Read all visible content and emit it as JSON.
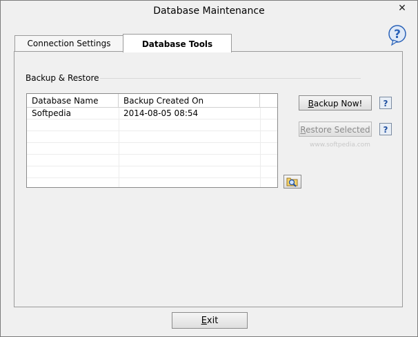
{
  "window": {
    "title": "Database Maintenance",
    "close_glyph": "✕"
  },
  "tabs": [
    {
      "label": "Connection Settings"
    },
    {
      "label": "Database Tools"
    }
  ],
  "group": {
    "label": "Backup & Restore"
  },
  "table": {
    "columns": [
      "Database Name",
      "Backup Created On"
    ],
    "rows": [
      [
        "Softpedia",
        "2014-08-05   08:54"
      ]
    ]
  },
  "buttons": {
    "backup_prefix": "B",
    "backup_rest": "ackup Now!",
    "restore_prefix": "R",
    "restore_rest": "estore Selected",
    "help": "?",
    "exit_prefix": "E",
    "exit_rest": "xit"
  },
  "watermark": "www.softpedia.com",
  "icons": {
    "help_bubble": "help-bubble-icon",
    "browse": "folder-search-icon"
  },
  "colors": {
    "background": "#f0f0f0",
    "help_blue": "#2a62b8"
  }
}
